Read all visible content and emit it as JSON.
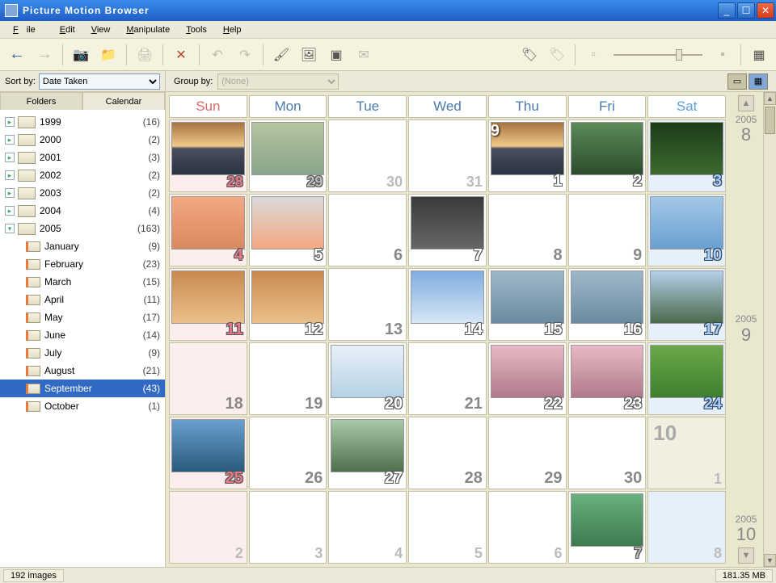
{
  "window": {
    "title": "Picture Motion Browser"
  },
  "menu": {
    "file": "File",
    "edit": "Edit",
    "view": "View",
    "manipulate": "Manipulate",
    "tools": "Tools",
    "help": "Help"
  },
  "sidebar": {
    "sort_label": "Sort by:",
    "sort_value": "Date Taken",
    "tabs": {
      "folders": "Folders",
      "calendar": "Calendar"
    },
    "years": [
      {
        "label": "1999",
        "count": "(16)"
      },
      {
        "label": "2000",
        "count": "(2)"
      },
      {
        "label": "2001",
        "count": "(3)"
      },
      {
        "label": "2002",
        "count": "(2)"
      },
      {
        "label": "2003",
        "count": "(2)"
      },
      {
        "label": "2004",
        "count": "(4)"
      },
      {
        "label": "2005",
        "count": "(163)"
      }
    ],
    "months": [
      {
        "label": "January",
        "count": "(9)"
      },
      {
        "label": "February",
        "count": "(23)"
      },
      {
        "label": "March",
        "count": "(15)"
      },
      {
        "label": "April",
        "count": "(11)"
      },
      {
        "label": "May",
        "count": "(17)"
      },
      {
        "label": "June",
        "count": "(14)"
      },
      {
        "label": "July",
        "count": "(9)"
      },
      {
        "label": "August",
        "count": "(21)"
      },
      {
        "label": "September",
        "count": "(43)",
        "selected": true
      },
      {
        "label": "October",
        "count": "(1)"
      }
    ]
  },
  "groupbar": {
    "label": "Group by:",
    "value": "(None)"
  },
  "calendar": {
    "heads": [
      "Sun",
      "Mon",
      "Tue",
      "Wed",
      "Thu",
      "Fri",
      "Sat"
    ],
    "rail": {
      "prev": "2005",
      "prev_m": "8",
      "cur": "2005",
      "cur_m": "9",
      "next": "2005",
      "next_m": "10"
    },
    "cells": [
      {
        "n": "28",
        "cls": "sun other hasimg",
        "tg": "tg-sunset"
      },
      {
        "n": "29",
        "cls": "other hasimg",
        "tg": "tg-sky"
      },
      {
        "n": "30",
        "cls": "other noimg"
      },
      {
        "n": "31",
        "cls": "other noimg"
      },
      {
        "n": "1",
        "cls": "hasimg",
        "tg": "tg-sunset",
        "badge": "9"
      },
      {
        "n": "2",
        "cls": "hasimg",
        "tg": "tg-bird"
      },
      {
        "n": "3",
        "cls": "sat hasimg",
        "tg": "tg-forest"
      },
      {
        "n": "4",
        "cls": "sun hasimg",
        "tg": "tg-dog1"
      },
      {
        "n": "5",
        "cls": "hasimg",
        "tg": "tg-dog2"
      },
      {
        "n": "6",
        "cls": "noimg"
      },
      {
        "n": "7",
        "cls": "hasimg",
        "tg": "tg-cat"
      },
      {
        "n": "8",
        "cls": "noimg"
      },
      {
        "n": "9",
        "cls": "noimg"
      },
      {
        "n": "10",
        "cls": "sat hasimg",
        "tg": "tg-blue"
      },
      {
        "n": "11",
        "cls": "sun hasimg",
        "tg": "tg-dog3"
      },
      {
        "n": "12",
        "cls": "hasimg",
        "tg": "tg-dog3"
      },
      {
        "n": "13",
        "cls": "noimg"
      },
      {
        "n": "14",
        "cls": "hasimg",
        "tg": "tg-swan"
      },
      {
        "n": "15",
        "cls": "hasimg",
        "tg": "tg-cloud"
      },
      {
        "n": "16",
        "cls": "hasimg",
        "tg": "tg-cloud"
      },
      {
        "n": "17",
        "cls": "sat hasimg",
        "tg": "tg-mtn"
      },
      {
        "n": "18",
        "cls": "sun noimg"
      },
      {
        "n": "19",
        "cls": "noimg"
      },
      {
        "n": "20",
        "cls": "hasimg",
        "tg": "tg-gull"
      },
      {
        "n": "21",
        "cls": "noimg"
      },
      {
        "n": "22",
        "cls": "hasimg",
        "tg": "tg-blossom"
      },
      {
        "n": "23",
        "cls": "hasimg",
        "tg": "tg-blossom"
      },
      {
        "n": "24",
        "cls": "sat hasimg",
        "tg": "tg-grass"
      },
      {
        "n": "25",
        "cls": "sun hasimg",
        "tg": "tg-sea"
      },
      {
        "n": "26",
        "cls": "noimg"
      },
      {
        "n": "27",
        "cls": "hasimg",
        "tg": "tg-lake"
      },
      {
        "n": "28",
        "cls": "noimg"
      },
      {
        "n": "29",
        "cls": "noimg"
      },
      {
        "n": "30",
        "cls": "noimg"
      },
      {
        "n": "1",
        "cls": "sat nextmonth other",
        "big": "10"
      },
      {
        "n": "2",
        "cls": "sun other noimg"
      },
      {
        "n": "3",
        "cls": "other noimg"
      },
      {
        "n": "4",
        "cls": "other noimg"
      },
      {
        "n": "5",
        "cls": "other noimg"
      },
      {
        "n": "6",
        "cls": "other noimg"
      },
      {
        "n": "7",
        "cls": "other hasimg",
        "tg": "tg-green"
      },
      {
        "n": "8",
        "cls": "sat other noimg"
      }
    ]
  },
  "status": {
    "left": "192 images",
    "right": "181.35 MB"
  }
}
